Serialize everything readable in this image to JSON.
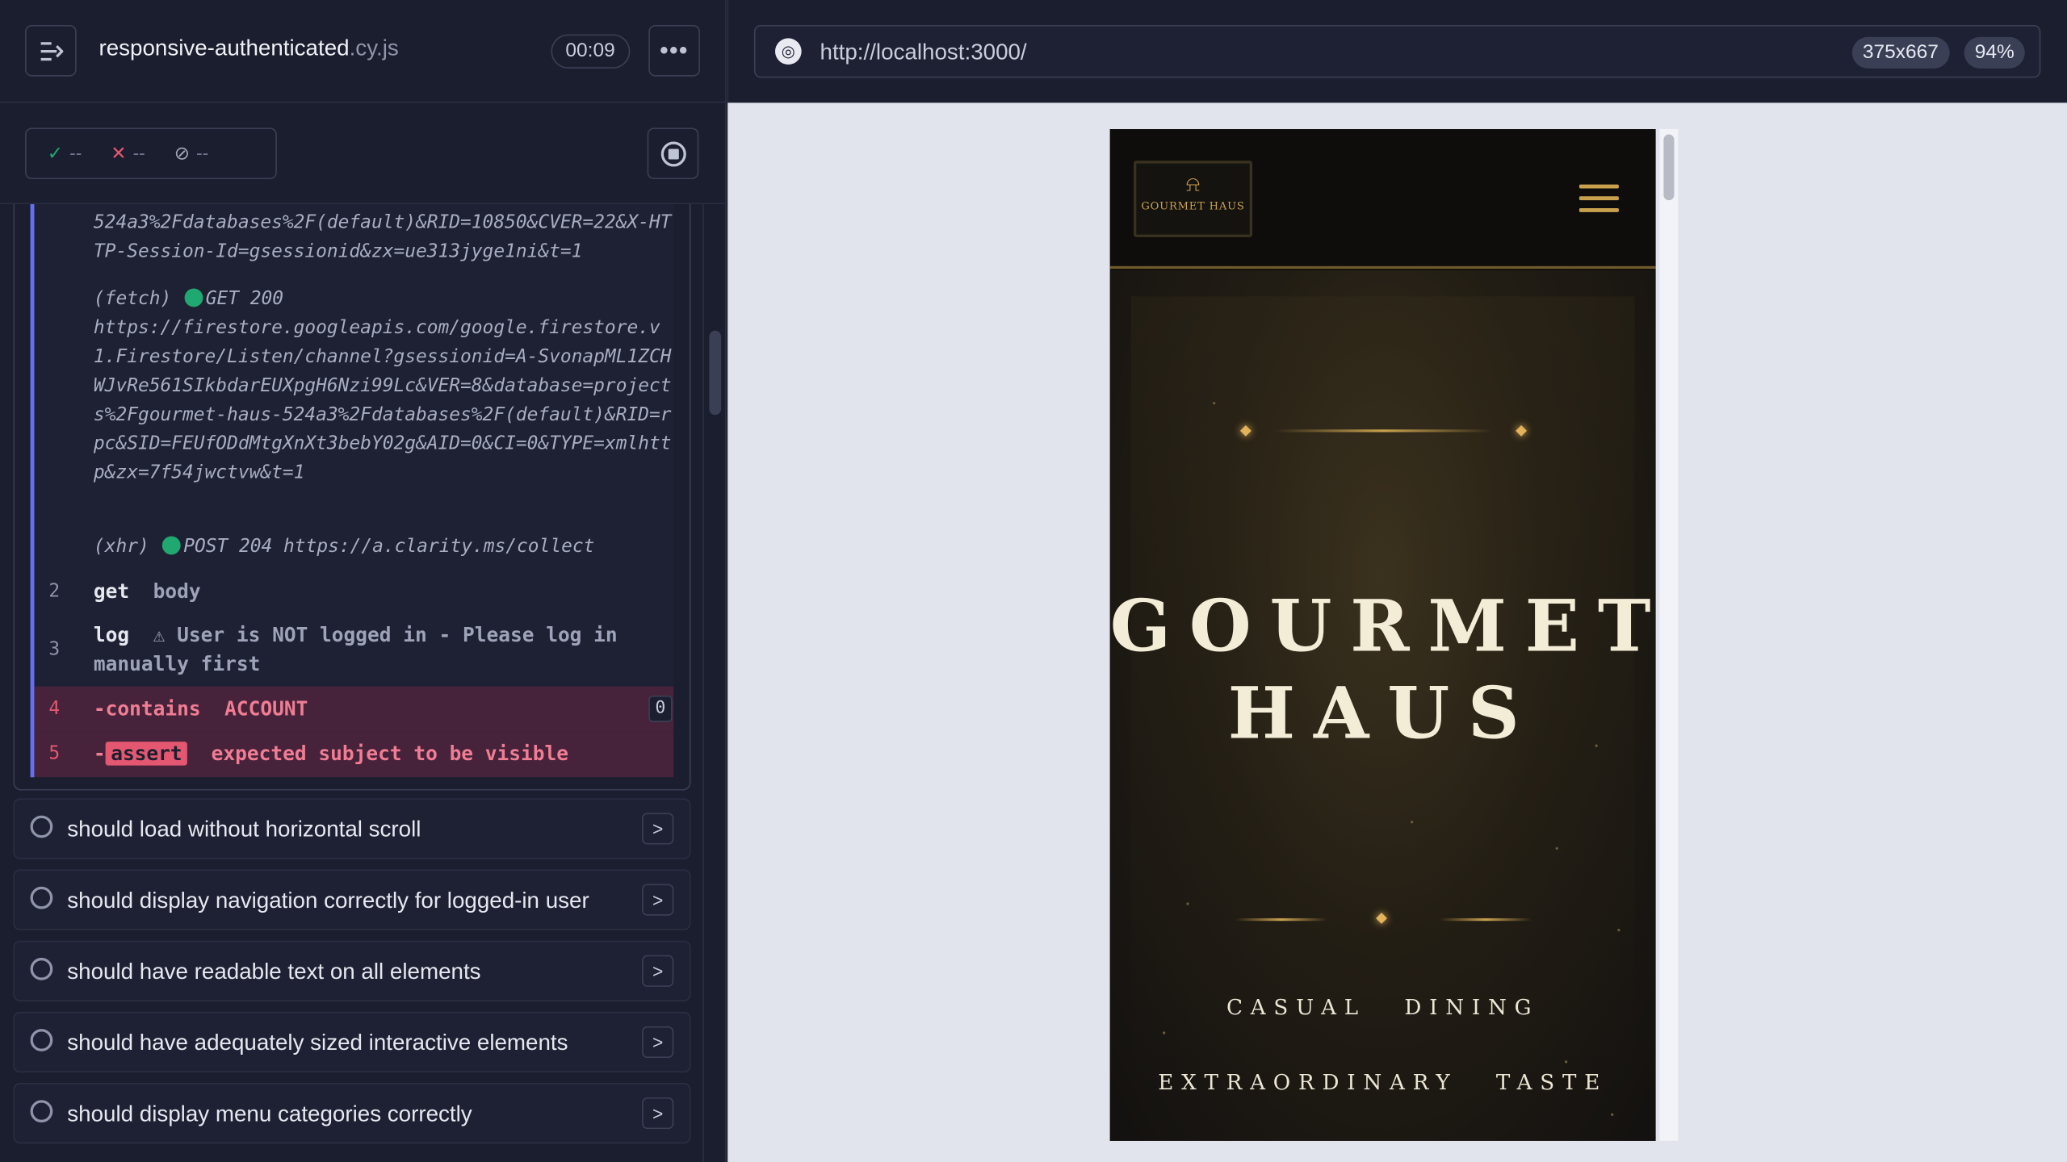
{
  "header": {
    "spec_name": "responsive-authenticated",
    "spec_ext": ".cy.js",
    "timer": "00:09"
  },
  "stats": {
    "passed": "--",
    "failed": "--",
    "pending": "--"
  },
  "log": {
    "fetch_tail": "524a3%2Fdatabases%2F(default)&RID=10850&CVER=22&X-HTTP-Session-Id=gsessionid&zx=ue313jyge1ni&t=1",
    "fetch_label": "(fetch)",
    "fetch_method": "GET 200",
    "fetch_url": "https://firestore.googleapis.com/google.firestore.v1.Firestore/Listen/channel?gsessionid=A-SvonapML1ZCHWJvRe561SIkbdarEUXpgH6Nzi99Lc&VER=8&database=projects%2Fgourmet-haus-524a3%2Fdatabases%2F(default)&RID=rpc&SID=FEUfODdMtgXnXt3bebY02g&AID=0&CI=0&TYPE=xmlhttp&zx=7f54jwctvw&t=1",
    "xhr_label": "(xhr)",
    "xhr_text": "POST 204 https://a.clarity.ms/collect",
    "commands": [
      {
        "num": "2",
        "cmd": "get",
        "msg": "body"
      },
      {
        "num": "3",
        "cmd": "log",
        "msg": "⚠ User is NOT logged in - Please log in manually first"
      },
      {
        "num": "4",
        "cmd": "-contains",
        "msg": "ACCOUNT",
        "badge": "0"
      },
      {
        "num": "5",
        "cmd": "-",
        "pill": "assert",
        "msg": "expected subject to be visible"
      }
    ]
  },
  "tests": [
    "should load without horizontal scroll",
    "should display navigation correctly for logged-in user",
    "should have readable text on all elements",
    "should have adequately sized interactive elements",
    "should display menu categories correctly"
  ],
  "browser": {
    "url": "http://localhost:3000/",
    "viewport": "375x667",
    "zoom": "94%"
  },
  "site": {
    "logo_text": "GOURMET HAUS",
    "hero_line1": "GOURMET",
    "hero_line2": "HAUS",
    "tagline1": "CASUAL DINING",
    "tagline2": "EXTRAORDINARY TASTE"
  },
  "colors": {
    "accent_gold": "#c9a14e",
    "pass_green": "#1fa971",
    "fail_red": "#e45770",
    "runner_bg": "#1b1e2e"
  }
}
